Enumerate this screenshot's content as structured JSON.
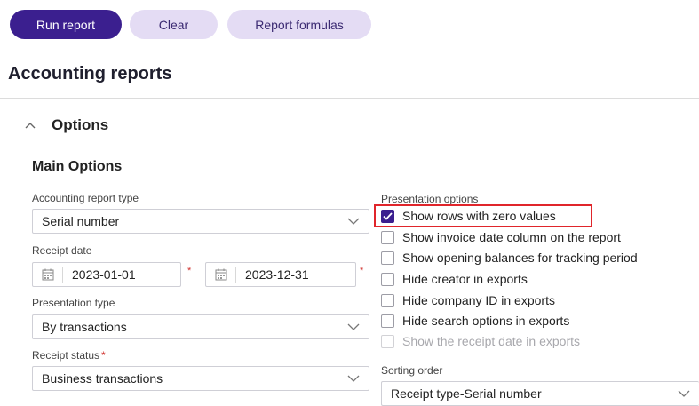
{
  "toolbar": {
    "run_report": "Run report",
    "clear": "Clear",
    "report_formulas": "Report formulas"
  },
  "page": {
    "title": "Accounting reports"
  },
  "options": {
    "section_title": "Options",
    "main_options_title": "Main Options",
    "accounting_report_type": {
      "label": "Accounting report type",
      "value": "Serial number"
    },
    "receipt_date": {
      "label": "Receipt date",
      "start": "2023-01-01",
      "end": "2023-12-31"
    },
    "presentation_type": {
      "label": "Presentation type",
      "value": "By transactions"
    },
    "receipt_status": {
      "label": "Receipt status",
      "value": "Business transactions"
    },
    "presentation_options": {
      "label": "Presentation options",
      "items": [
        {
          "label": "Show rows with zero values",
          "checked": true,
          "disabled": false
        },
        {
          "label": "Show invoice date column on the report",
          "checked": false,
          "disabled": false
        },
        {
          "label": "Show opening balances for tracking period",
          "checked": false,
          "disabled": false
        },
        {
          "label": "Hide creator in exports",
          "checked": false,
          "disabled": false
        },
        {
          "label": "Hide company ID in exports",
          "checked": false,
          "disabled": false
        },
        {
          "label": "Hide search options in exports",
          "checked": false,
          "disabled": false
        },
        {
          "label": "Show the receipt date in exports",
          "checked": false,
          "disabled": true
        }
      ]
    },
    "sorting_order": {
      "label": "Sorting order",
      "value": "Receipt type-Serial number"
    }
  },
  "colors": {
    "primary": "#3b1f8f",
    "secondary": "#e4dcf4",
    "highlight": "#e0252b",
    "required": "#d0312d"
  }
}
